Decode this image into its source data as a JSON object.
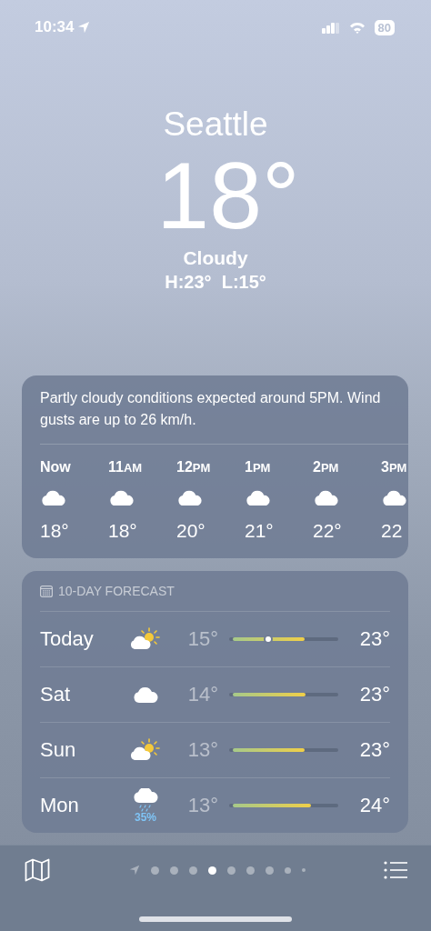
{
  "status_bar": {
    "time": "10:34",
    "battery": "80"
  },
  "header": {
    "city": "Seattle",
    "temperature": "18°",
    "condition": "Cloudy",
    "high_low": "H:23°  L:15°"
  },
  "hourly": {
    "summary": "Partly cloudy conditions expected around 5PM. Wind gusts are up to 26 km/h.",
    "hours": [
      {
        "hour": "Now",
        "kind": "cloudy",
        "temp": "18°"
      },
      {
        "hour": "11",
        "suffix": "AM",
        "kind": "cloudy",
        "temp": "18°"
      },
      {
        "hour": "12",
        "suffix": "PM",
        "kind": "cloudy",
        "temp": "20°"
      },
      {
        "hour": "1",
        "suffix": "PM",
        "kind": "cloudy",
        "temp": "21°"
      },
      {
        "hour": "2",
        "suffix": "PM",
        "kind": "cloudy",
        "temp": "22°"
      },
      {
        "hour": "3",
        "suffix": "PM",
        "kind": "cloudy",
        "temp": "22"
      }
    ]
  },
  "forecast": {
    "title": "10-DAY FORECAST",
    "days": [
      {
        "day": "Today",
        "kind": "partly-sunny",
        "low": "15°",
        "high": "23°",
        "level": 0.69,
        "current_marker": true
      },
      {
        "day": "Sat",
        "kind": "cloudy",
        "low": "14°",
        "high": "23°",
        "level": 0.7,
        "current_marker": false
      },
      {
        "day": "Sun",
        "kind": "partly-sunny",
        "low": "13°",
        "high": "23°",
        "level": 0.69,
        "current_marker": false
      },
      {
        "day": "Mon",
        "kind": "rain",
        "precipitation": "35%",
        "low": "13°",
        "high": "24°",
        "level": 0.75,
        "current_marker": false
      }
    ]
  },
  "pages": [
    {
      "kind": "location",
      "selected": false
    },
    {
      "kind": "dot",
      "selected": false
    },
    {
      "kind": "dot",
      "selected": false
    },
    {
      "kind": "dot",
      "selected": false
    },
    {
      "kind": "dot",
      "selected": true
    },
    {
      "kind": "dot",
      "selected": false
    },
    {
      "kind": "dot",
      "selected": false
    },
    {
      "kind": "dot",
      "selected": false
    },
    {
      "kind": "small",
      "selected": false
    },
    {
      "kind": "tiny",
      "selected": false
    }
  ]
}
